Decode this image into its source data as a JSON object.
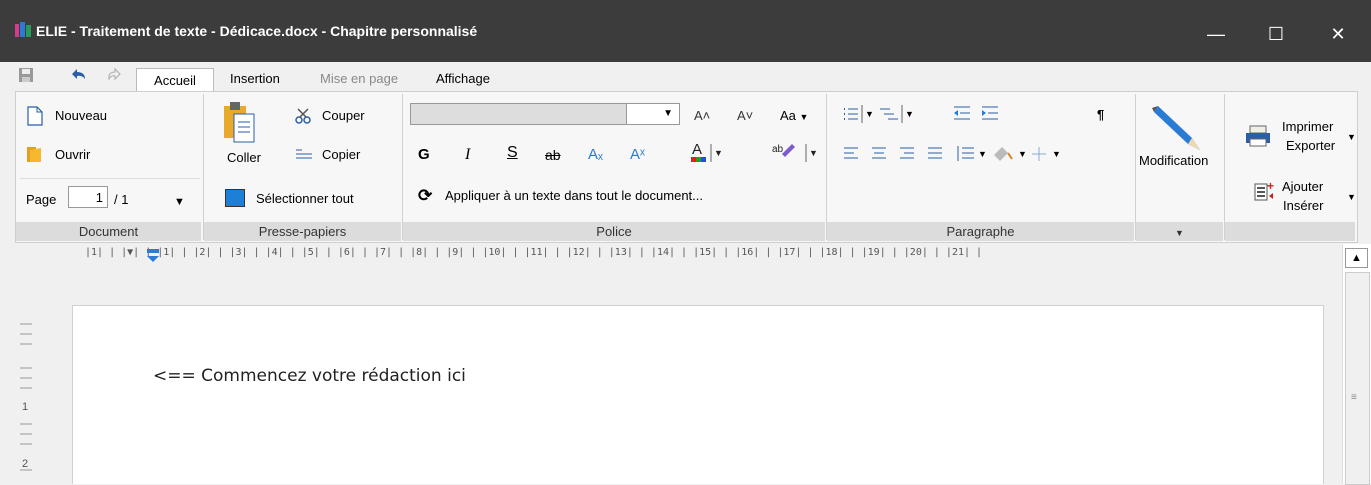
{
  "window": {
    "title": "ELIE - Traitement de texte - Dédicace.docx - Chapitre personnalisé",
    "minimize": "—",
    "maximize": "☐",
    "close": "✕"
  },
  "tabs": [
    "Accueil",
    "Insertion",
    "Mise en page",
    "Affichage"
  ],
  "groups": {
    "document": {
      "label": "Document",
      "nouveau": "Nouveau",
      "ouvrir": "Ouvrir",
      "page_label": "Page",
      "page_value": "1",
      "page_total": "/ 1"
    },
    "presse_papiers": {
      "label": "Presse-papiers",
      "coller": "Coller",
      "couper": "Couper",
      "copier": "Copier",
      "selectionner": "Sélectionner tout"
    },
    "police": {
      "label": "Police",
      "font_value": "",
      "bold": "G",
      "italic": "I",
      "underline": "S",
      "strike": "ab",
      "subscript": "Aₓ",
      "superscript": "Aˣ",
      "grow": "A˄",
      "shrink": "A˅",
      "case": "Aa",
      "apply_all": "Appliquer à un texte dans tout le document..."
    },
    "paragraphe": {
      "label": "Paragraphe",
      "pilcrow": "¶"
    },
    "modification": {
      "label": "Modification"
    },
    "export": {
      "imprimer": "Imprimer",
      "exporter": "Exporter",
      "ajouter": "Ajouter",
      "inserer": "Insérer"
    }
  },
  "ruler": {
    "marks": "|1| | |▼| | |1| | |2| | |3| | |4| | |5| | |6| | |7| | |8| | |9| | |10| | |11| | |12| | |13| | |14| | |15| | |16| | |17| | |18| | |19| | |20| | |21| |"
  },
  "vruler": [
    "1",
    "2"
  ],
  "document": {
    "text": "<== Commencez votre rédaction ici"
  },
  "colors": {
    "titlebar": "#3c3c3c",
    "accent": "#1e6fd9"
  }
}
